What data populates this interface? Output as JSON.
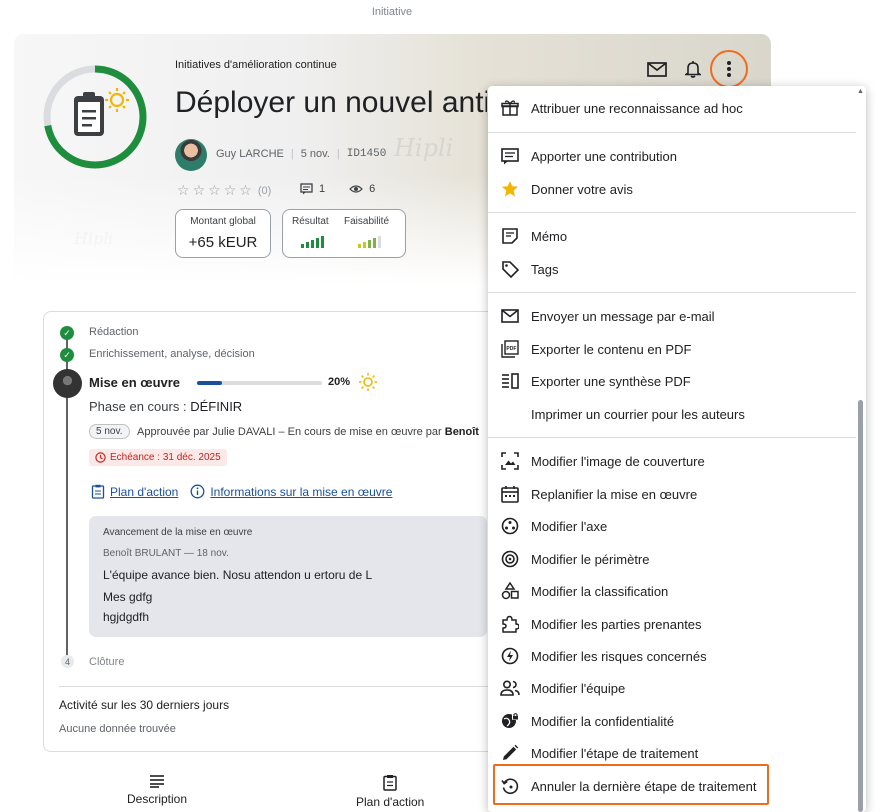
{
  "page": {
    "top_label": "Initiative"
  },
  "hero": {
    "category": "Initiatives d'amélioration continue",
    "title": "Déployer un nouvel antiv",
    "author": "Guy LARCHE",
    "date": "5 nov.",
    "id": "ID1450",
    "rating_count": "(0)",
    "comments_count": "1",
    "views_count": "6",
    "progress_fraction": 0.72,
    "montant_label": "Montant global",
    "montant_value": "+65 kEUR",
    "resultat_label": "Résultat",
    "faisabilite_label": "Faisabilité",
    "resultat_bars": 5,
    "faisabilite_bars": 4,
    "colors": {
      "green": "#1e8e3e",
      "gray": "#dadce0",
      "sun": "#f2b705"
    }
  },
  "timeline": {
    "step1": "Rédaction",
    "step2": "Enrichissement, analyse, décision",
    "phase_name": "Mise en œuvre",
    "phase_progress": 0.2,
    "phase_percent": "20%",
    "phase_current_label": "Phase en cours :",
    "phase_current_value": "DÉFINIR",
    "date_chip": "5 nov.",
    "approved_text": "Approuvée par Julie DAVALI – En cours de mise en œuvre par",
    "approved_by": "Benoît",
    "deadline": "Echéance : 31 déc. 2025",
    "link_plan": "Plan d'action",
    "link_info": "Informations sur la mise en œuvre",
    "comment_title": "Avancement de la mise en œuvre",
    "comment_author": "Benoît BRULANT — 18 nov.",
    "comment_lines": [
      "L'équipe avance bien. Nosu attendon u ertoru de L",
      "Mes gdfg",
      "hgjdgdfh"
    ],
    "step4_number": "4",
    "step4": "Clôture",
    "activity_title": "Activité sur les 30 derniers jours",
    "activity_empty": "Aucune donnée trouvée"
  },
  "tabs": {
    "description": "Description",
    "plan": "Plan d'action"
  },
  "menu": {
    "items": [
      "Attribuer une reconnaissance ad hoc",
      "Apporter une contribution",
      "Donner votre avis",
      "Mémo",
      "Tags",
      "Envoyer un message par e-mail",
      "Exporter le contenu en PDF",
      "Exporter une synthèse PDF",
      "Imprimer un courrier pour les auteurs",
      "Modifier l'image de couverture",
      "Replanifier la mise en œuvre",
      "Modifier l'axe",
      "Modifier le périmètre",
      "Modifier la classification",
      "Modifier les parties prenantes",
      "Modifier les risques concernés",
      "Modifier l'équipe",
      "Modifier la confidentialité",
      "Modifier l'étape de traitement",
      "Annuler la dernière étape de traitement"
    ],
    "highlight_color": "#f26b1d"
  }
}
